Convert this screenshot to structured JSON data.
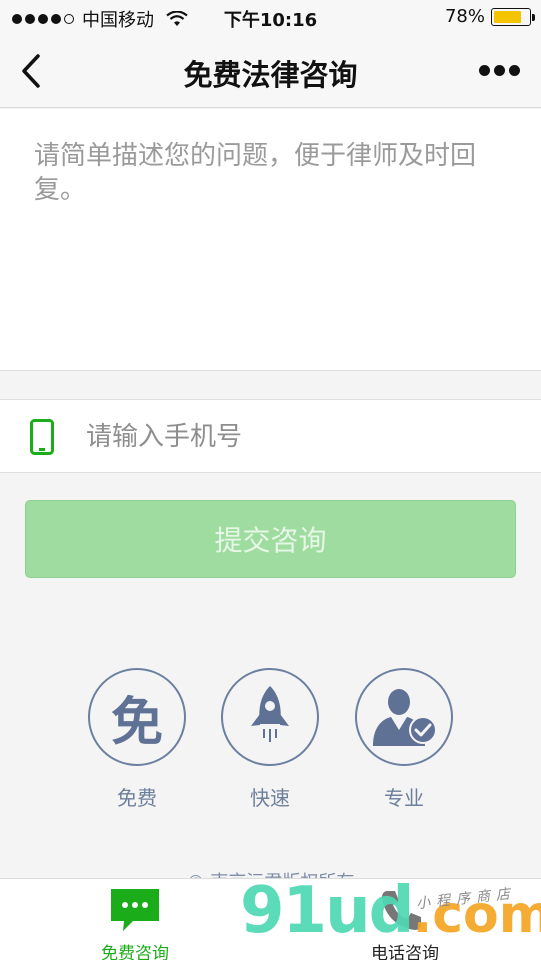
{
  "status_bar": {
    "carrier": "中国移动",
    "time": "下午10:16",
    "battery_percent": "78%",
    "battery_level": 0.78,
    "signal_bars_filled": 4,
    "signal_bars_total": 5
  },
  "nav": {
    "title": "免费法律咨询",
    "back_icon": "chevron-left-icon",
    "more_icon": "more-dots-icon"
  },
  "question": {
    "placeholder": "请简单描述您的问题，便于律师及时回复。",
    "value": ""
  },
  "phone": {
    "placeholder": "请输入手机号",
    "value": "",
    "icon": "mobile-phone-icon"
  },
  "submit": {
    "label": "提交咨询",
    "color": "#9fdc9f"
  },
  "features": [
    {
      "glyph": "免",
      "label": "免费",
      "icon": "mian-character-icon"
    },
    {
      "label": "快速",
      "icon": "rocket-icon"
    },
    {
      "label": "专业",
      "icon": "professional-person-check-icon"
    }
  ],
  "copyright": "© 南京沅君版权所有",
  "tabs": [
    {
      "label": "免费咨询",
      "icon": "chat-bubble-icon",
      "active": true
    },
    {
      "label": "电话咨询",
      "icon": "phone-handset-icon",
      "active": false
    }
  ],
  "watermark": {
    "main": "91ud",
    "suffix": ".com",
    "tagline": "小程序商店"
  },
  "colors": {
    "accent_green": "#1aad19",
    "feature_blue": "#6b7fa0",
    "submit_text": "#e7f7e7"
  }
}
